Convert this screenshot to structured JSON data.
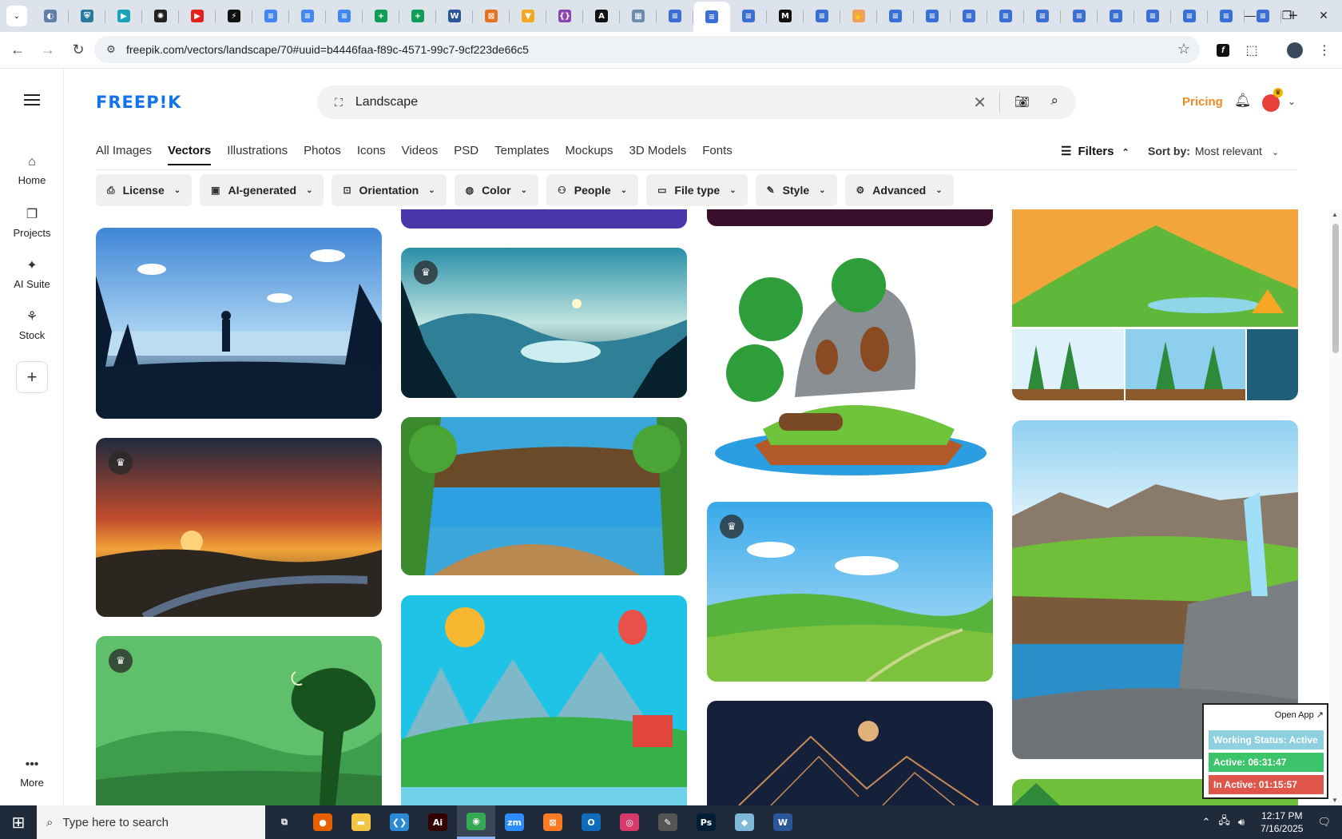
{
  "browser": {
    "url": "freepik.com/vectors/landscape/70#uuid=b4446faa-f89c-4571-99c7-9cf223de66c5",
    "tabs": [
      {
        "icon": "globe-icon",
        "color": "#5f7fa8",
        "g": "◐"
      },
      {
        "icon": "shield-icon",
        "color": "#2b7a9e",
        "g": "⛨"
      },
      {
        "icon": "teal-icon",
        "color": "#1aa3b8",
        "g": "▶"
      },
      {
        "icon": "openai-icon",
        "color": "#222222",
        "g": "✺"
      },
      {
        "icon": "youtube-icon",
        "color": "#e62117",
        "g": "▶"
      },
      {
        "icon": "bolt-icon",
        "color": "#111111",
        "g": "⚡"
      },
      {
        "icon": "docs-icon",
        "color": "#4285f4",
        "g": "≡"
      },
      {
        "icon": "docs-icon",
        "color": "#4285f4",
        "g": "≡"
      },
      {
        "icon": "docs-icon",
        "color": "#4285f4",
        "g": "≡"
      },
      {
        "icon": "sheets-icon",
        "color": "#0f9d58",
        "g": "+"
      },
      {
        "icon": "sheets-icon",
        "color": "#0f9d58",
        "g": "+"
      },
      {
        "icon": "word-icon",
        "color": "#2b579a",
        "g": "W"
      },
      {
        "icon": "box-icon",
        "color": "#e8721c",
        "g": "⊠"
      },
      {
        "icon": "fox-icon",
        "color": "#f5a623",
        "g": "▼"
      },
      {
        "icon": "braces-icon",
        "color": "#8e44ad",
        "g": "{}"
      },
      {
        "icon": "a-icon",
        "color": "#111111",
        "g": "A"
      },
      {
        "icon": "grid-icon",
        "color": "#6b8cae",
        "g": "▦"
      },
      {
        "icon": "forms-icon",
        "color": "#3b6fd8",
        "g": "≡"
      },
      {
        "icon": "forms-icon",
        "color": "#3b6fd8",
        "g": "≡",
        "active": true
      },
      {
        "icon": "forms-icon",
        "color": "#3b6fd8",
        "g": "≡"
      },
      {
        "icon": "m-icon",
        "color": "#111111",
        "g": "M"
      },
      {
        "icon": "forms-icon",
        "color": "#3b6fd8",
        "g": "≡"
      },
      {
        "icon": "hand-icon",
        "color": "#f0a060",
        "g": "✋"
      },
      {
        "icon": "forms-icon",
        "color": "#3b6fd8",
        "g": "≡"
      },
      {
        "icon": "forms-icon",
        "color": "#3b6fd8",
        "g": "≡"
      },
      {
        "icon": "forms-icon",
        "color": "#3b6fd8",
        "g": "≡"
      },
      {
        "icon": "forms-icon",
        "color": "#3b6fd8",
        "g": "≡"
      },
      {
        "icon": "forms-icon",
        "color": "#3b6fd8",
        "g": "≡"
      },
      {
        "icon": "forms-icon",
        "color": "#3b6fd8",
        "g": "≡"
      },
      {
        "icon": "forms-icon",
        "color": "#3b6fd8",
        "g": "≡"
      },
      {
        "icon": "forms-icon",
        "color": "#3b6fd8",
        "g": "≡"
      },
      {
        "icon": "forms-icon",
        "color": "#3b6fd8",
        "g": "≡"
      },
      {
        "icon": "forms-icon",
        "color": "#3b6fd8",
        "g": "≡"
      },
      {
        "icon": "forms-icon",
        "color": "#3b6fd8",
        "g": "≡"
      }
    ]
  },
  "brand": {
    "logo": "FREEP!K",
    "accent": "#1273eb",
    "pricing_color": "#f08a24"
  },
  "sidebar": {
    "items": [
      {
        "label": "Home",
        "icon": "home-icon"
      },
      {
        "label": "Projects",
        "icon": "projects-icon"
      },
      {
        "label": "AI Suite",
        "icon": "sparkle-icon"
      },
      {
        "label": "Stock",
        "icon": "stock-icon"
      }
    ],
    "more": "More"
  },
  "header": {
    "search_value": "Landscape",
    "pricing": "Pricing"
  },
  "categories": [
    "All Images",
    "Vectors",
    "Illustrations",
    "Photos",
    "Icons",
    "Videos",
    "PSD",
    "Templates",
    "Mockups",
    "3D Models",
    "Fonts"
  ],
  "active_category": "Vectors",
  "toolbar": {
    "filters": "Filters",
    "sort_label": "Sort by:",
    "sort_value": "Most relevant"
  },
  "filter_buttons": [
    "License",
    "AI-generated",
    "Orientation",
    "Color",
    "People",
    "File type",
    "Style",
    "Advanced"
  ],
  "results": [
    {
      "id": "lake-silhouette",
      "premium": false
    },
    {
      "id": "sunset-river",
      "premium": true
    },
    {
      "id": "deer-night",
      "premium": true
    },
    {
      "id": "mountain-lake",
      "premium": true
    },
    {
      "id": "forest-lake",
      "premium": false
    },
    {
      "id": "balloon-village",
      "premium": false
    },
    {
      "id": "island-house",
      "premium": false
    },
    {
      "id": "green-hills",
      "premium": true
    },
    {
      "id": "golden-mountains",
      "premium": false
    },
    {
      "id": "camp-mountain",
      "premium": false
    },
    {
      "id": "waterfall-bridge",
      "premium": false
    }
  ],
  "work_widget": {
    "open_app": "Open App ↗",
    "status": "Working Status: Active",
    "active": "Active: 06:31:47",
    "inactive": "In Active: 01:15:57",
    "colors": {
      "status": "#8fd0e0",
      "active": "#3cc46a",
      "inactive": "#e0554a"
    }
  },
  "taskbar": {
    "search_placeholder": "Type here to search",
    "time": "12:17 PM",
    "date": "7/16/2025",
    "apps": [
      {
        "icon": "task-view-icon",
        "color": "#ffffff",
        "g": "⧉"
      },
      {
        "icon": "firefox-icon",
        "color": "#e66000",
        "g": "●"
      },
      {
        "icon": "explorer-icon",
        "color": "#f4c542",
        "g": "▬"
      },
      {
        "icon": "vscode-icon",
        "color": "#2a8ad4",
        "g": "❮❯"
      },
      {
        "icon": "illustrator-icon",
        "color": "#330000",
        "g": "Ai"
      },
      {
        "icon": "chrome-icon",
        "color": "#34a853",
        "g": "◉",
        "active": true
      },
      {
        "icon": "zoom-icon",
        "color": "#2d8cff",
        "g": "zm"
      },
      {
        "icon": "xampp-icon",
        "color": "#fb7a24",
        "g": "⊠"
      },
      {
        "icon": "outlook-icon",
        "color": "#0f6cbd",
        "g": "O"
      },
      {
        "icon": "creative-cloud-icon",
        "color": "#d63a6b",
        "g": "◎"
      },
      {
        "icon": "pen-icon",
        "color": "#555555",
        "g": "✎"
      },
      {
        "icon": "photoshop-icon",
        "color": "#001e36",
        "g": "Ps"
      },
      {
        "icon": "gem-icon",
        "color": "#7fb8d8",
        "g": "◆"
      },
      {
        "icon": "word-icon",
        "color": "#2b579a",
        "g": "W"
      }
    ]
  }
}
